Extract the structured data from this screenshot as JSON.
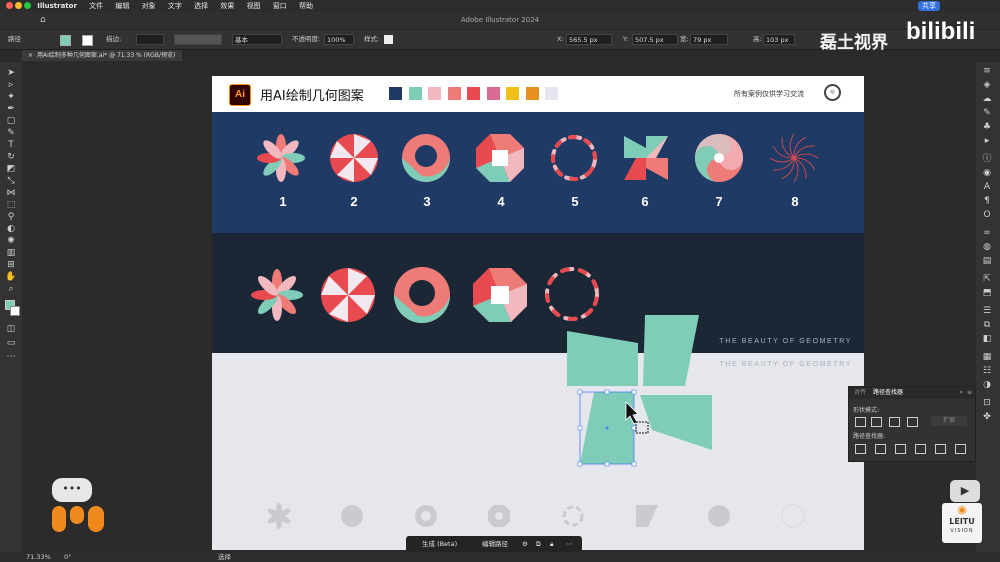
{
  "menubar": {
    "app_name": "Illustrator",
    "items": [
      "文件",
      "编辑",
      "对象",
      "文字",
      "选择",
      "效果",
      "视图",
      "窗口",
      "帮助"
    ],
    "share_button": "共享"
  },
  "titlebar": {
    "title": "Adobe Illustrator 2024"
  },
  "controlbar": {
    "object_type": "路径",
    "stroke_label": "描边:",
    "stroke_style": "基本",
    "opacity_label": "不透明度:",
    "opacity_value": "100%",
    "style_label": "样式:",
    "x_label": "X:",
    "x_value": "565.5 px",
    "y_label": "Y:",
    "y_value": "507.5 px",
    "w_label": "宽:",
    "w_value": "79 px",
    "h_label": "高:",
    "h_value": "103 px"
  },
  "doc_tab": {
    "label": "用AI绘制多种几何图案.ai* @ 71.33 % (RGB/预览)"
  },
  "artboard": {
    "title": "用AI绘制几何图案",
    "disclaimer": "所有案例仅供学习交流",
    "swatches": [
      "#1f3a64",
      "#7fcdb9",
      "#f2b8bf",
      "#ee7b78",
      "#e84a4f",
      "#d96a93",
      "#f2bf1a",
      "#e8911e",
      "#e6e4ee"
    ],
    "numbers": [
      "1",
      "2",
      "3",
      "4",
      "5",
      "6",
      "7",
      "8"
    ],
    "tagline_1": "THE BEAUTY OF GEOMETRY",
    "tagline_2": "THE BEAUTY OF GEOMETRY",
    "colors": {
      "navy": "#1f3a64",
      "dark": "#1b2735",
      "mint": "#7fcdb9",
      "pink": "#f2b8bf",
      "coral": "#ee7b78",
      "red": "#e84a4f",
      "rose": "#d96a93"
    }
  },
  "pathfinder_panel": {
    "tab_align": "对齐",
    "tab_pathfinder": "路径查找器",
    "shape_modes_label": "形状模式:",
    "expand_button": "扩展",
    "pathfinders_label": "路径查找器:"
  },
  "context_bar": {
    "generate": "生成 (Beta)",
    "edit_path": "编辑路径"
  },
  "statusbar": {
    "zoom": "71.33%",
    "rotation": "0°",
    "tool": "选择"
  },
  "watermark": {
    "channel": "磊土视界",
    "bilibili": "bilibili",
    "leitu": "LEITU",
    "vision": "VISION"
  }
}
